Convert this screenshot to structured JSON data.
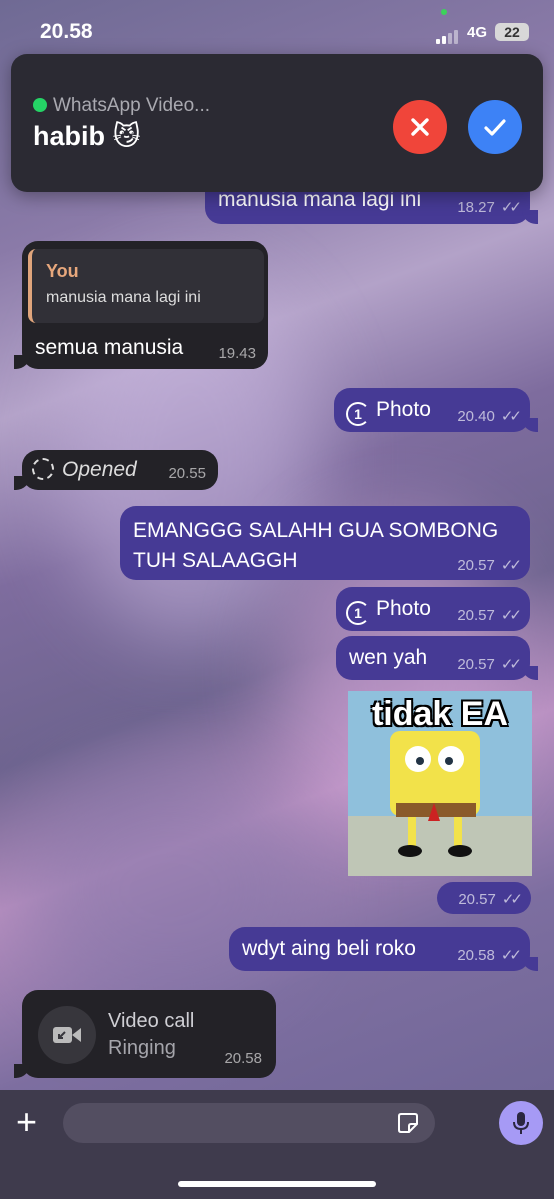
{
  "status_bar": {
    "time": "20.58",
    "network": "4G",
    "battery": "22"
  },
  "call_banner": {
    "app_label": "WhatsApp Video...",
    "caller_name": "habib 😼",
    "decline_icon": "close-icon",
    "accept_icon": "check-icon"
  },
  "messages": [
    {
      "text": "manusia mana lagi ini",
      "time": "18.27"
    },
    {
      "reply_author": "You",
      "reply_text": "manusia mana lagi ini",
      "text": "semua manusia",
      "time": "19.43"
    },
    {
      "text": "Photo",
      "time": "20.40",
      "badge": "1"
    },
    {
      "text": "Opened",
      "time": "20.55"
    },
    {
      "line1": "EMANGGG SALAHH GUA SOMBONG",
      "line2": "TUH SALAAGGH",
      "time": "20.57"
    },
    {
      "text": "Photo",
      "time": "20.57",
      "badge": "1"
    },
    {
      "text": "wen yah",
      "time": "20.57"
    },
    {
      "sticker_text": "tidak EA",
      "time": "20.57"
    },
    {
      "text": "wdyt aing beli roko",
      "time": "20.58"
    },
    {
      "title": "Video call",
      "subtitle": "Ringing",
      "time": "20.58"
    }
  ],
  "composer": {
    "placeholder": ""
  },
  "colors": {
    "outgoing": "#463a95",
    "incoming": "#232227",
    "decline": "#f0453a",
    "accept": "#3d82f6",
    "mic": "#a69af5"
  }
}
